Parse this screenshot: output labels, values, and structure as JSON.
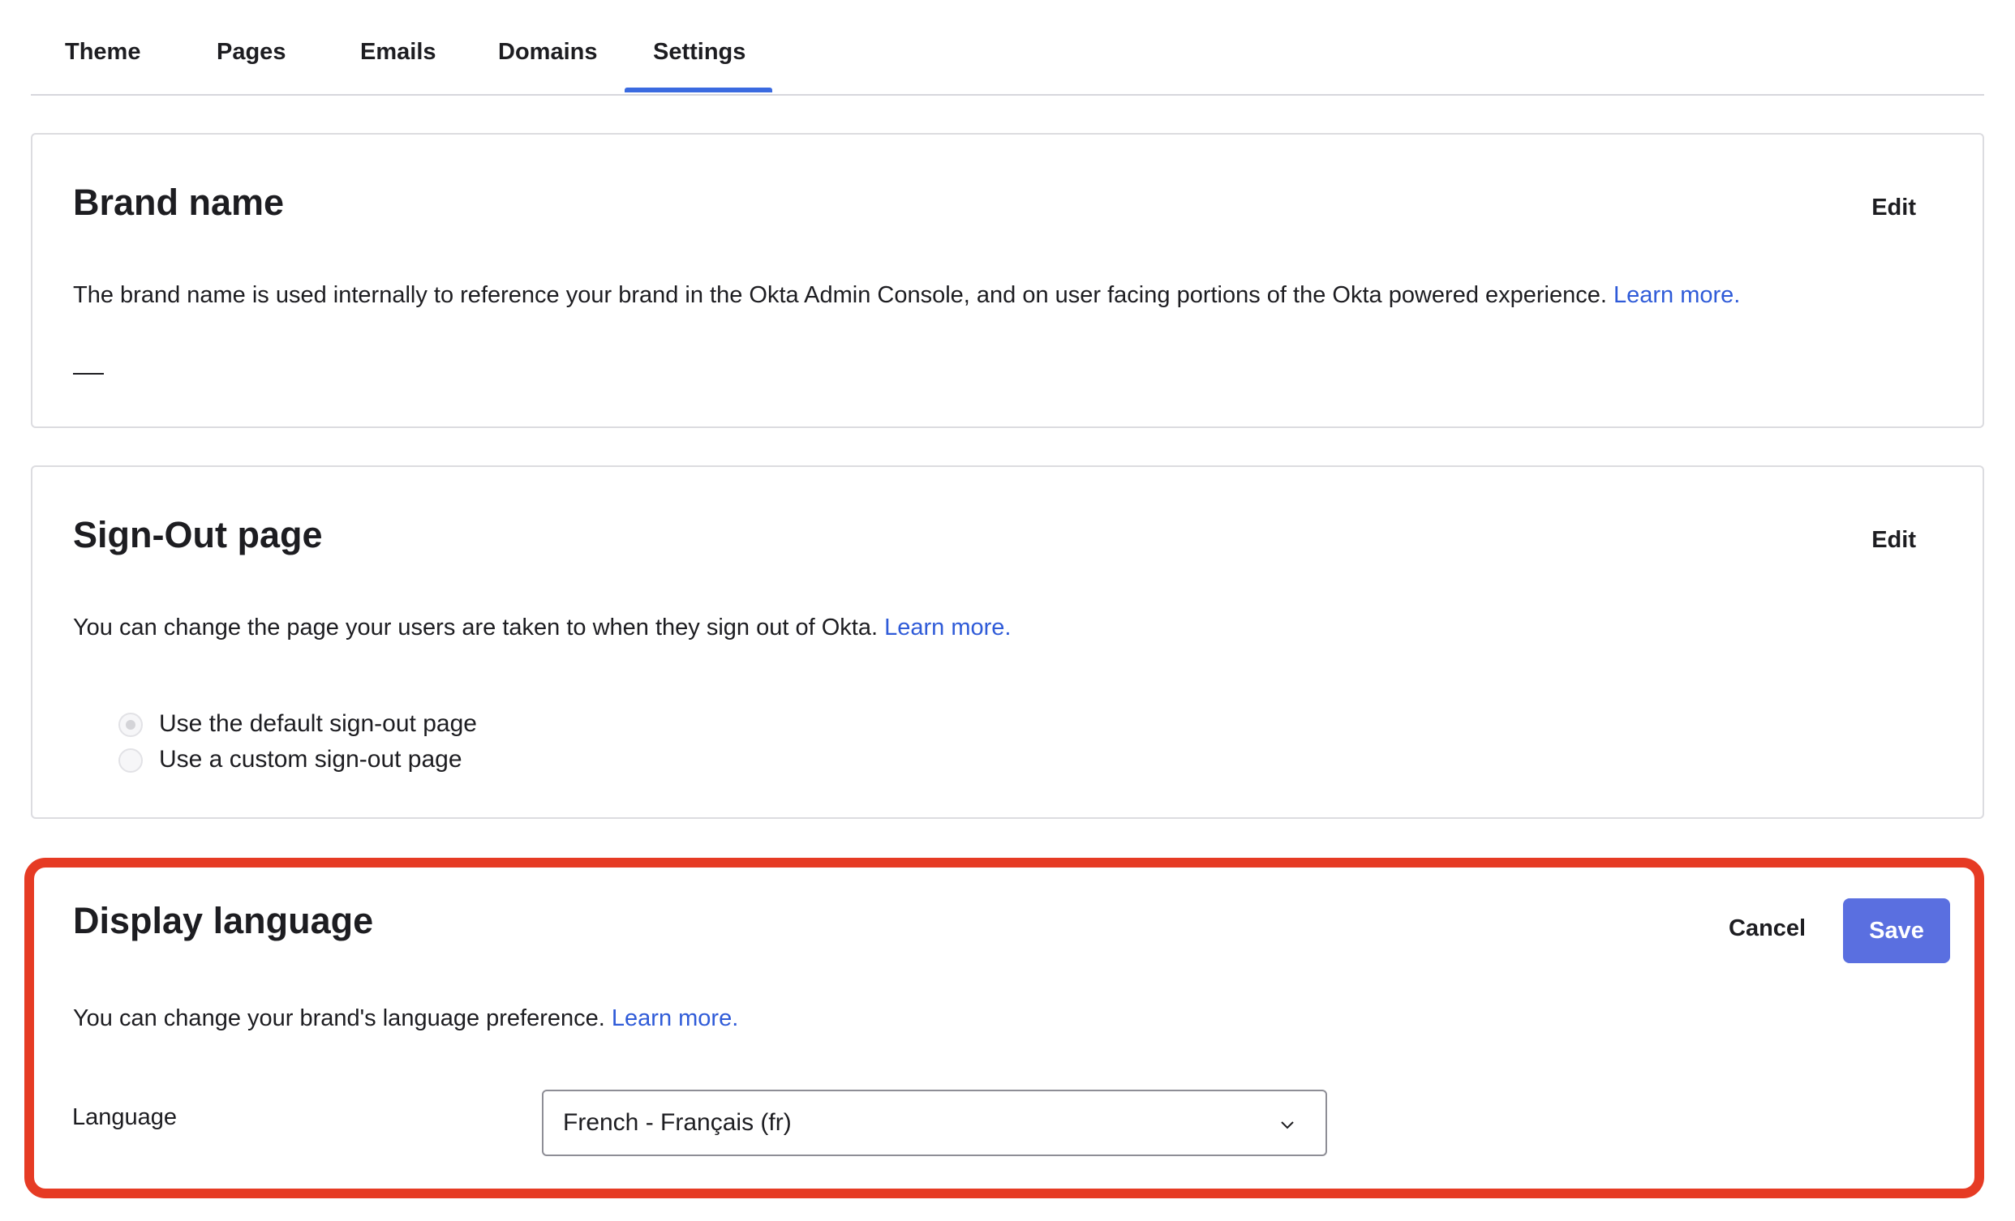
{
  "tabs": [
    {
      "label": "Theme"
    },
    {
      "label": "Pages"
    },
    {
      "label": "Emails"
    },
    {
      "label": "Domains"
    },
    {
      "label": "Settings",
      "active": true
    }
  ],
  "brand_name": {
    "title": "Brand name",
    "edit_label": "Edit",
    "description": "The brand name is used internally to reference your brand in the Okta Admin Console, and on user facing portions of the Okta powered experience.",
    "link": "Learn more.",
    "value": ""
  },
  "sign_out": {
    "title": "Sign-Out page",
    "edit_label": "Edit",
    "description": "You can change the page your users are taken to when they sign out of Okta.",
    "link": "Learn more.",
    "options": [
      {
        "label": "Use the default sign-out page",
        "selected": true
      },
      {
        "label": "Use a custom sign-out page",
        "selected": false
      }
    ]
  },
  "display_language": {
    "title": "Display language",
    "cancel_label": "Cancel",
    "save_label": "Save",
    "description": "You can change your brand's language preference.",
    "link": "Learn more.",
    "field_label": "Language",
    "selected_value": "French - Français (fr)"
  },
  "colors": {
    "accent": "#3a6ae0",
    "link": "#2f5bd8",
    "save_button": "#5a6fe0",
    "highlight": "#e63b24"
  }
}
